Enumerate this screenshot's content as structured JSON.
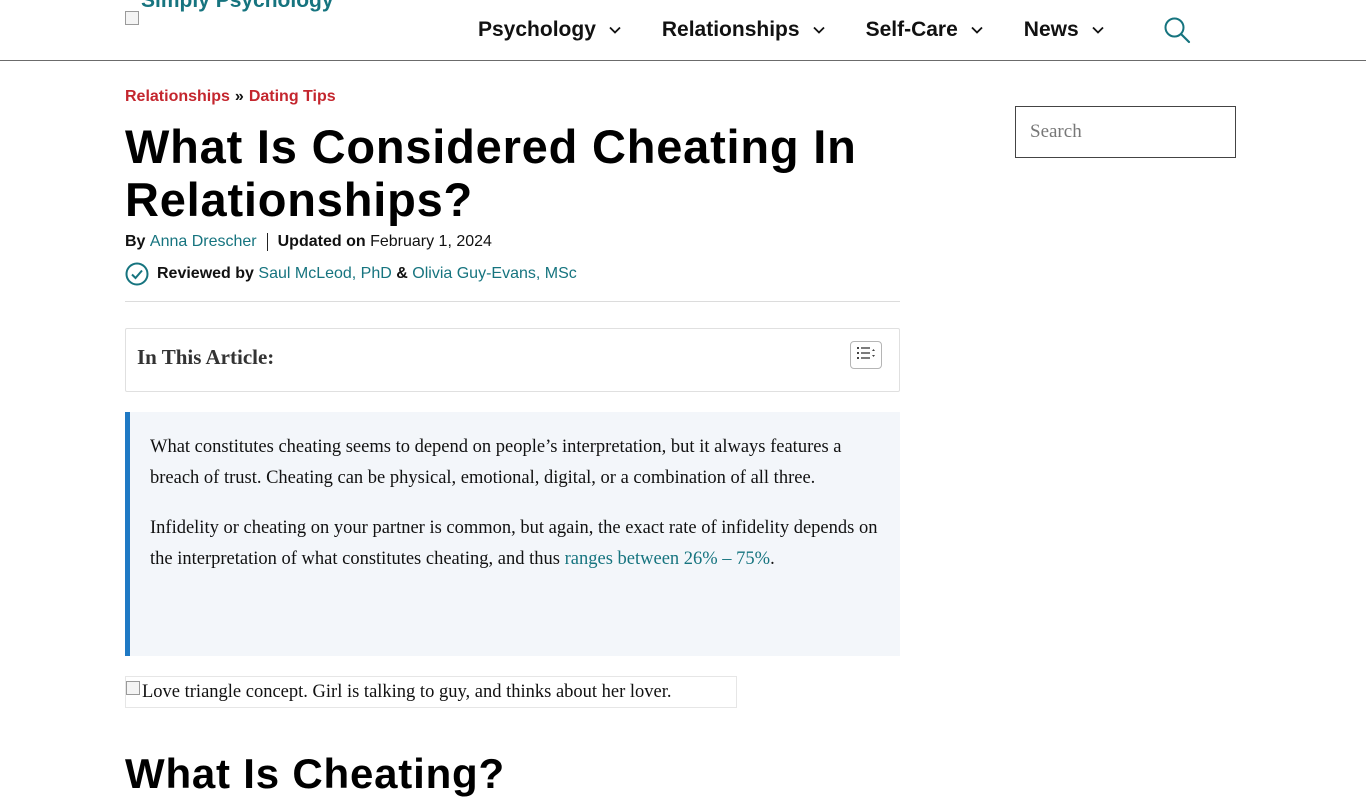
{
  "header": {
    "logo_alt": "Simply Psychology",
    "nav": [
      {
        "label": "Psychology"
      },
      {
        "label": "Relationships"
      },
      {
        "label": "Self-Care"
      },
      {
        "label": "News"
      }
    ]
  },
  "breadcrumb": {
    "items": [
      "Relationships",
      "Dating Tips"
    ],
    "separator": "»"
  },
  "article": {
    "title": "What Is Considered Cheating In Relationships?",
    "byline": {
      "by_label": "By",
      "author": "Anna Drescher",
      "updated_label": "Updated on",
      "updated_date": "February 1, 2024"
    },
    "reviewed": {
      "label": "Reviewed by",
      "reviewer1": "Saul McLeod, PhD",
      "joiner": "&",
      "reviewer2": "Olivia Guy-Evans, MSc"
    },
    "toc_title": "In This Article:",
    "key_points": {
      "p1": "What constitutes cheating seems to depend on people’s interpretation, but it always features a breach of trust. Cheating can be physical, emotional, digital, or a combination of all three.",
      "p2_text": "Infidelity or cheating on your partner is common, but again, the exact rate of infidelity depends on the interpretation of what constitutes cheating, and thus ",
      "p2_link": "ranges between 26% – 75%",
      "p2_end": "."
    },
    "hero_image_alt": "Love triangle concept. Girl is talking to guy, and thinks about her lover.",
    "section_heading": "What Is Cheating?"
  },
  "sidebar": {
    "search_placeholder": "Search"
  },
  "colors": {
    "brand_teal": "#16747f",
    "breadcrumb_red": "#c4262e",
    "keypoints_border": "#1f79c4",
    "keypoints_bg": "#f3f6fa"
  },
  "icons": {
    "search": "search-icon",
    "nav_chevron": "chevron-down-icon",
    "reviewed": "check-circle-icon",
    "toc_toggle": "list-toggle-icon"
  }
}
